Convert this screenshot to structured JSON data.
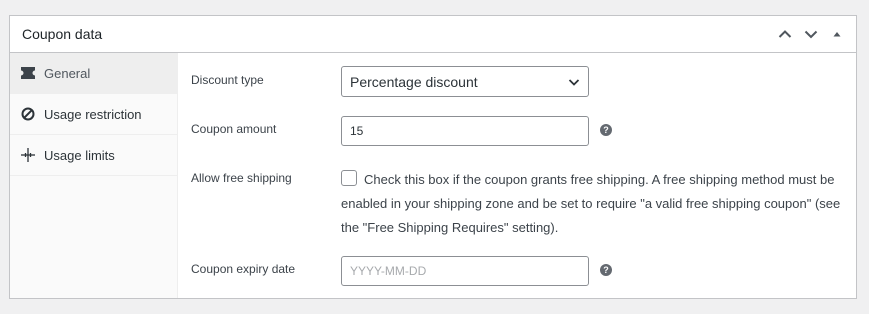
{
  "box": {
    "title": "Coupon data",
    "actions": {
      "up_icon": "chevron-up-icon",
      "down_icon": "chevron-down-icon",
      "toggle_icon": "triangle-up-icon"
    }
  },
  "tabs": [
    {
      "label": "General",
      "icon": "ticket-icon",
      "active": true
    },
    {
      "label": "Usage restriction",
      "icon": "ban-icon",
      "active": false
    },
    {
      "label": "Usage limits",
      "icon": "crosshair-icon",
      "active": false
    }
  ],
  "fields": {
    "discount_type": {
      "label": "Discount type",
      "value": "Percentage discount"
    },
    "coupon_amount": {
      "label": "Coupon amount",
      "value": "15"
    },
    "free_shipping": {
      "label": "Allow free shipping",
      "checked": false,
      "description": "Check this box if the coupon grants free shipping. A free shipping method must be enabled in your shipping zone and be set to require \"a valid free shipping coupon\" (see the \"Free Shipping Requires\" setting)."
    },
    "expiry_date": {
      "label": "Coupon expiry date",
      "placeholder": "YYYY-MM-DD"
    },
    "help_glyph": "?"
  },
  "colors": {
    "background": "#f0f0f1",
    "border": "#c3c4c7",
    "input_border": "#8c8f94",
    "help_icon": "#646970",
    "active_tab": "#eeeeee"
  }
}
